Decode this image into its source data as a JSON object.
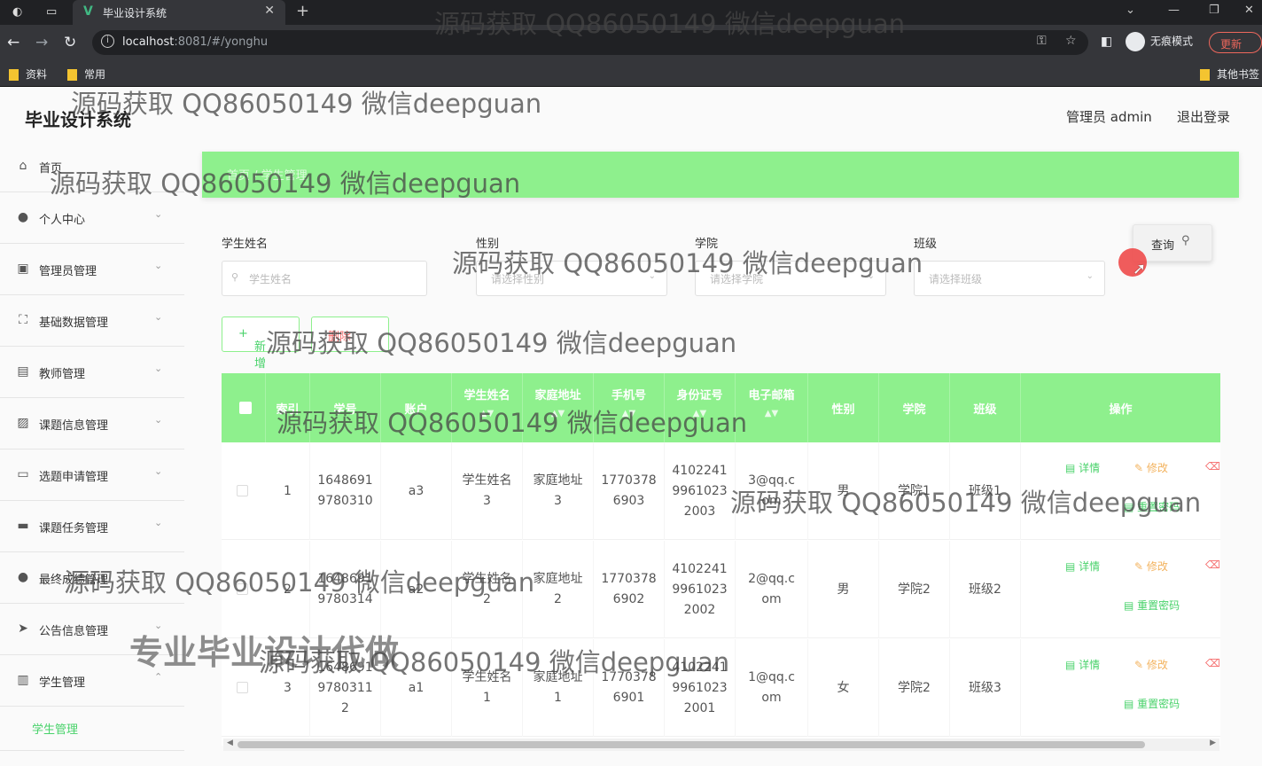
{
  "browser": {
    "tab_title": "毕业设计系统",
    "url_host": "localhost",
    "url_path": ":8081/#/yonghu",
    "incognito_label": "无痕模式",
    "update_label": "更新",
    "bookmarks": [
      "资料",
      "常用"
    ],
    "other_bookmarks": "其他书签"
  },
  "app": {
    "title": "毕业设计系统",
    "user_label": "管理员 admin",
    "logout_label": "退出登录"
  },
  "sidebar": {
    "items": [
      {
        "label": "首页",
        "icon": "home-icon"
      },
      {
        "label": "个人中心",
        "icon": "user-icon"
      },
      {
        "label": "管理员管理",
        "icon": "clipboard-icon"
      },
      {
        "label": "基础数据管理",
        "icon": "frame-icon"
      },
      {
        "label": "教师管理",
        "icon": "card-icon"
      },
      {
        "label": "课题信息管理",
        "icon": "image-icon"
      },
      {
        "label": "选题申请管理",
        "icon": "chat-icon"
      },
      {
        "label": "课题任务管理",
        "icon": "monitor-icon"
      },
      {
        "label": "最终成绩管理",
        "icon": "bulb-icon"
      },
      {
        "label": "公告信息管理",
        "icon": "send-icon"
      },
      {
        "label": "学生管理",
        "icon": "chart-icon"
      }
    ],
    "active_sub": "学生管理"
  },
  "banner": {
    "crumb": "首页 / 学生管理"
  },
  "filters": {
    "name_label": "学生姓名",
    "name_placeholder": "学生姓名",
    "gender_label": "性别",
    "gender_placeholder": "请选择性别",
    "college_label": "学院",
    "college_placeholder": "请选择学院",
    "class_label": "班级",
    "class_placeholder": "请选择班级",
    "query_label": "查询"
  },
  "actions": {
    "add_label": "新增",
    "delete_label": "删除"
  },
  "table": {
    "headers": [
      "索引",
      "学号",
      "账户",
      "学生姓名",
      "家庭地址",
      "手机号",
      "身份证号",
      "电子邮箱",
      "性别",
      "学院",
      "班级",
      "操作"
    ],
    "rows": [
      {
        "index": "1",
        "sno": "1648691\n9780310",
        "account": "a3",
        "name": "学生姓名\n3",
        "addr": "家庭地址\n3",
        "phone": "1770378\n6903",
        "idcard": "4102241\n9961023\n2003",
        "email": "3@qq.c\nom",
        "gender": "男",
        "college": "学院1",
        "cls": "班级1"
      },
      {
        "index": "2",
        "sno": "1648691\n9780314",
        "account": "a2",
        "name": "学生姓名\n2",
        "addr": "家庭地址\n2",
        "phone": "1770378\n6902",
        "idcard": "4102241\n9961023\n2002",
        "email": "2@qq.c\nom",
        "gender": "男",
        "college": "学院2",
        "cls": "班级2"
      },
      {
        "index": "3",
        "sno": "1648691\n9780311\n2",
        "account": "a1",
        "name": "学生姓名\n1",
        "addr": "家庭地址\n1",
        "phone": "1770378\n6901",
        "idcard": "4102241\n9961023\n2001",
        "email": "1@qq.c\nom",
        "gender": "女",
        "college": "学院2",
        "cls": "班级3"
      }
    ],
    "op_detail": "详情",
    "op_edit": "修改",
    "op_reset": "重置密码"
  },
  "watermark": {
    "text": "源码获取 QQ86050149 微信deepguan",
    "big_text": "专业毕业设计代做"
  },
  "colors": {
    "accent": "#8ef08d",
    "accent_text": "#48d26a",
    "edit": "#f3b35f",
    "danger": "#f56c6c"
  }
}
